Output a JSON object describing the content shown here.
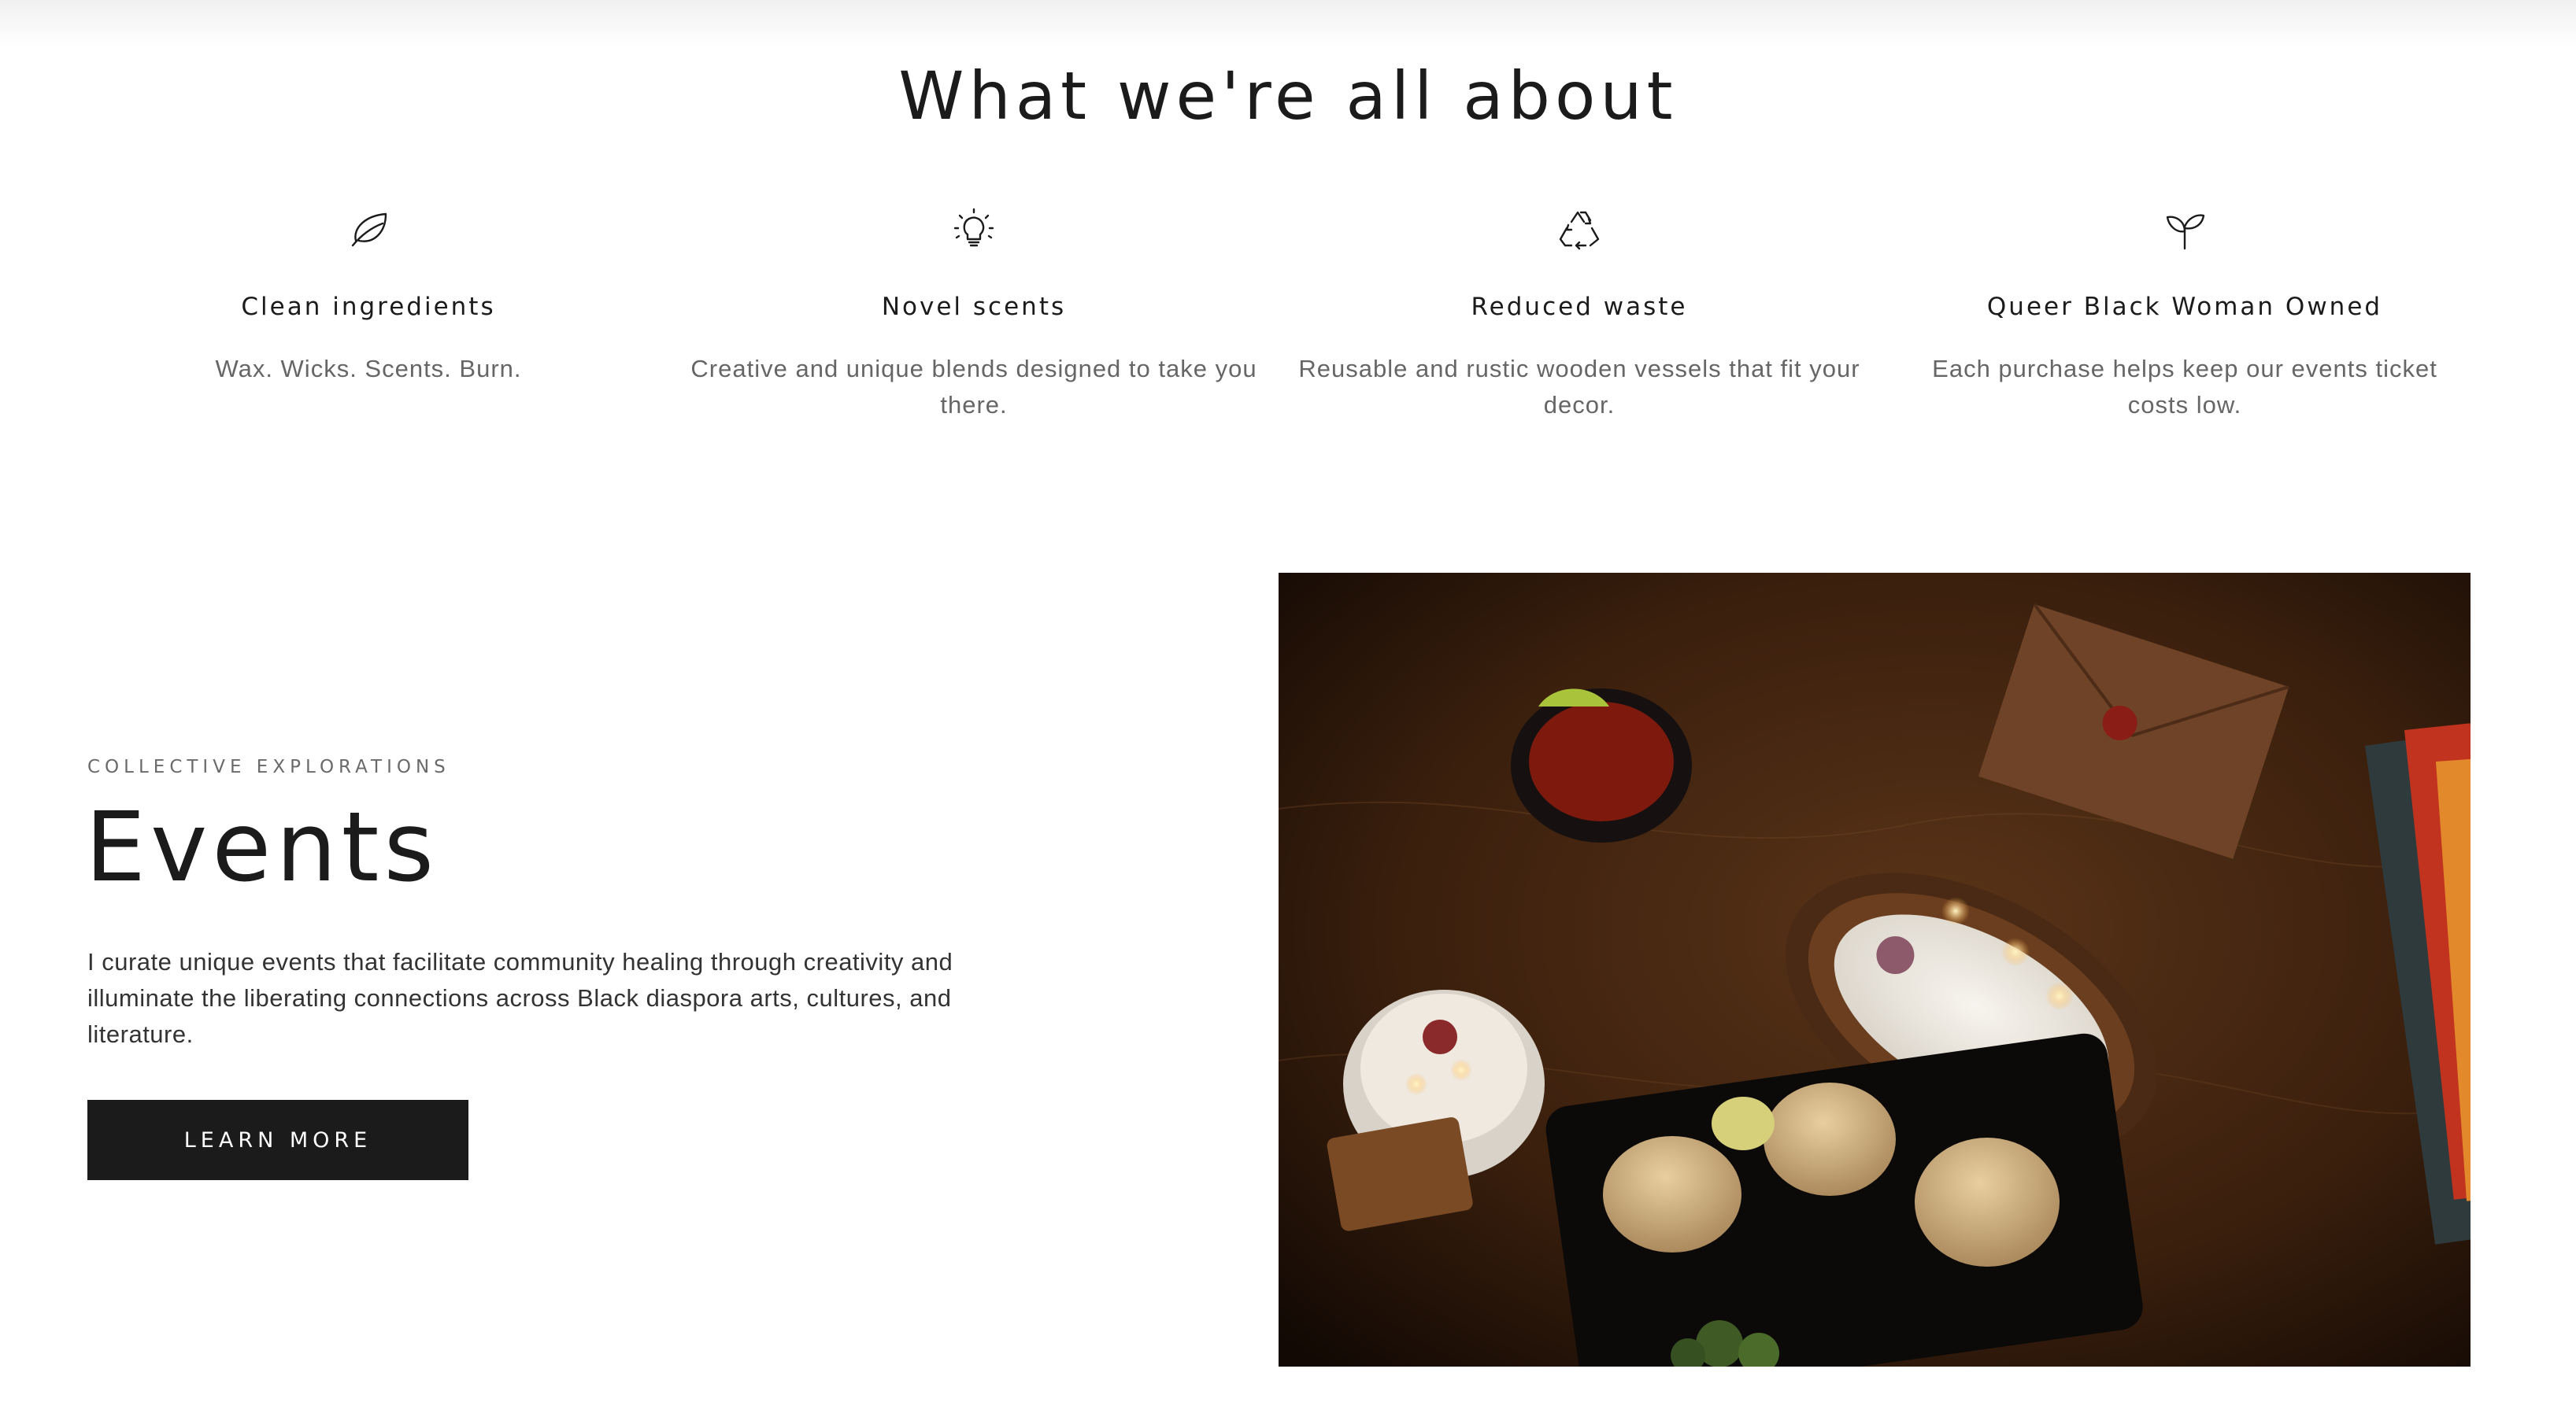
{
  "section": {
    "title": "What we're all about"
  },
  "features": [
    {
      "icon": "leaf-icon",
      "title": "Clean ingredients",
      "description": "Wax. Wicks. Scents. Burn."
    },
    {
      "icon": "lightbulb-icon",
      "title": "Novel scents",
      "description": "Creative and unique blends designed to take you there."
    },
    {
      "icon": "recycle-icon",
      "title": "Reduced waste",
      "description": "Reusable and rustic wooden vessels that fit your decor."
    },
    {
      "icon": "sprout-icon",
      "title": "Queer Black Woman Owned",
      "description": "Each purchase helps keep our events ticket costs low."
    }
  ],
  "events": {
    "eyebrow": "COLLECTIVE EXPLORATIONS",
    "heading": "Events",
    "body": "I curate unique events that facilitate community healing through creativity and illuminate the liberating connections across Black diaspora arts, cultures, and literature.",
    "button_label": "LEARN MORE"
  },
  "colors": {
    "text": "#1b1b1b",
    "muted": "#666666",
    "button_bg": "#1b1b1b",
    "button_text": "#ffffff",
    "background": "#ffffff"
  }
}
